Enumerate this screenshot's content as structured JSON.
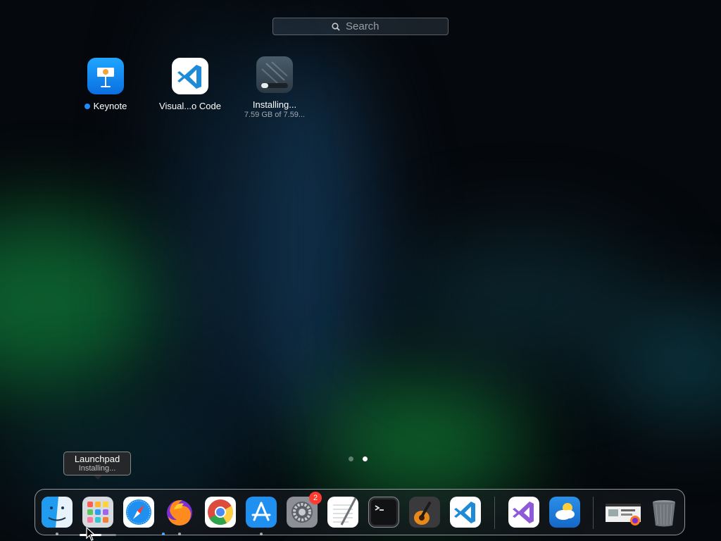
{
  "search": {
    "placeholder": "Search"
  },
  "apps": [
    {
      "label": "Keynote",
      "new_indicator": true
    },
    {
      "label": "Visual...o Code"
    },
    {
      "label": "Installing...",
      "sublabel": "7.59 GB of 7.59...",
      "progress": 0.25
    }
  ],
  "page_indicator": {
    "pages": 2,
    "current": 2
  },
  "tooltip": {
    "title": "Launchpad",
    "subtitle": "Installing..."
  },
  "dock": {
    "items": [
      {
        "name": "Finder",
        "icon": "finder-icon",
        "running": true
      },
      {
        "name": "Launchpad",
        "icon": "launchpad-icon",
        "running": false,
        "progress": 0.6
      },
      {
        "name": "Safari",
        "icon": "safari-icon",
        "running": false
      },
      {
        "name": "Firefox",
        "icon": "firefox-icon",
        "running": true
      },
      {
        "name": "Google Chrome",
        "icon": "chrome-icon",
        "running": true
      },
      {
        "name": "App Store",
        "icon": "app-store-icon",
        "running": true
      },
      {
        "name": "System Settings",
        "icon": "settings-icon",
        "running": false,
        "badge": "2"
      },
      {
        "name": "TextEdit",
        "icon": "textedit-icon",
        "running": false
      },
      {
        "name": "Terminal",
        "icon": "terminal-icon",
        "running": false
      },
      {
        "name": "GarageBand",
        "icon": "garageband-icon",
        "running": false
      },
      {
        "name": "Visual Studio Code",
        "icon": "vscode-icon",
        "running": false
      },
      {
        "name": "Visual Studio",
        "icon": "visual-studio-icon",
        "running": false
      },
      {
        "name": "Weather",
        "icon": "weather-icon",
        "running": false
      },
      {
        "name": "Downloads stack",
        "icon": "folder-stack-icon",
        "running": false
      },
      {
        "name": "Trash",
        "icon": "trash-icon",
        "running": false
      }
    ]
  },
  "colors": {
    "accent": "#1e8bff",
    "badge": "#ff3b30"
  }
}
